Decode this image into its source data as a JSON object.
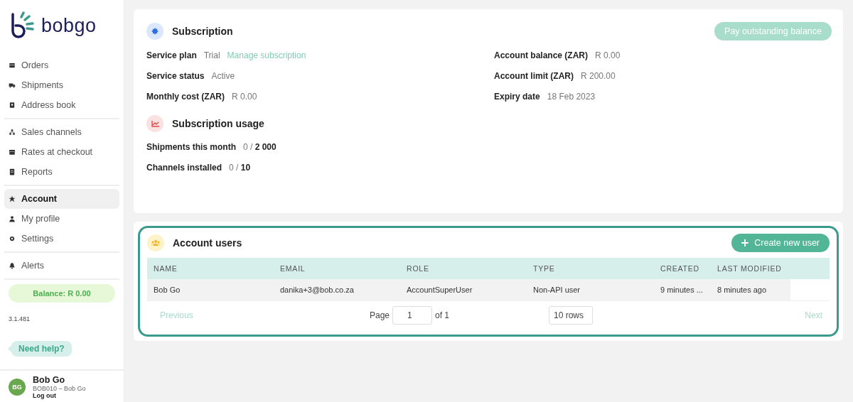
{
  "sidebar": {
    "logo": "bobgo",
    "nav_groups": [
      [
        {
          "label": "Orders",
          "selected": false
        },
        {
          "label": "Shipments",
          "selected": false
        },
        {
          "label": "Address book",
          "selected": false
        }
      ],
      [
        {
          "label": "Sales channels",
          "selected": false
        },
        {
          "label": "Rates at checkout",
          "selected": false
        },
        {
          "label": "Reports",
          "selected": false
        }
      ],
      [
        {
          "label": "Account",
          "selected": true
        },
        {
          "label": "My profile",
          "selected": false
        },
        {
          "label": "Settings",
          "selected": false
        }
      ],
      [
        {
          "label": "Alerts",
          "selected": false
        }
      ]
    ],
    "balance": "Balance: R 0.00",
    "version": "3.1.481",
    "help": "Need help?",
    "user": {
      "initials": "BG",
      "name": "Bob Go",
      "account": "BOB010 – Bob Go",
      "logout": "Log out"
    }
  },
  "subscription": {
    "title": "Subscription",
    "pay_button": {
      "label": "Pay outstanding balance",
      "disabled": true
    },
    "left": [
      {
        "label": "Service plan",
        "value": "Trial",
        "link": "Manage subscription"
      },
      {
        "label": "Service status",
        "value": "Active"
      },
      {
        "label": "Monthly cost (ZAR)",
        "value": "R 0.00"
      }
    ],
    "right": [
      {
        "label": "Account balance (ZAR)",
        "value": "R 0.00"
      },
      {
        "label": "Account limit (ZAR)",
        "value": "R 200.00"
      },
      {
        "label": "Expiry date",
        "value": "18 Feb 2023"
      }
    ]
  },
  "usage": {
    "title": "Subscription usage",
    "rows": [
      {
        "label": "Shipments this month",
        "used": "0 /",
        "limit": "2 000"
      },
      {
        "label": "Channels installed",
        "used": "0 /",
        "limit": "10"
      }
    ]
  },
  "account_users": {
    "title": "Account users",
    "create_button": "Create new user",
    "table": {
      "columns": [
        "NAME",
        "EMAIL",
        "ROLE",
        "TYPE",
        "CREATED",
        "LAST MODIFIED"
      ],
      "rows": [
        [
          "Bob Go",
          "danika+3@bob.co.za",
          "AccountSuperUser",
          "Non-API user",
          "9 minutes ...",
          "8 minutes ago"
        ]
      ]
    },
    "pagination": {
      "previous": {
        "label": "Previous",
        "disabled": true
      },
      "page_label": "Page",
      "page": "1",
      "of": "of 1",
      "rows": "10 rows",
      "next": {
        "label": "Next",
        "disabled": true
      }
    }
  }
}
